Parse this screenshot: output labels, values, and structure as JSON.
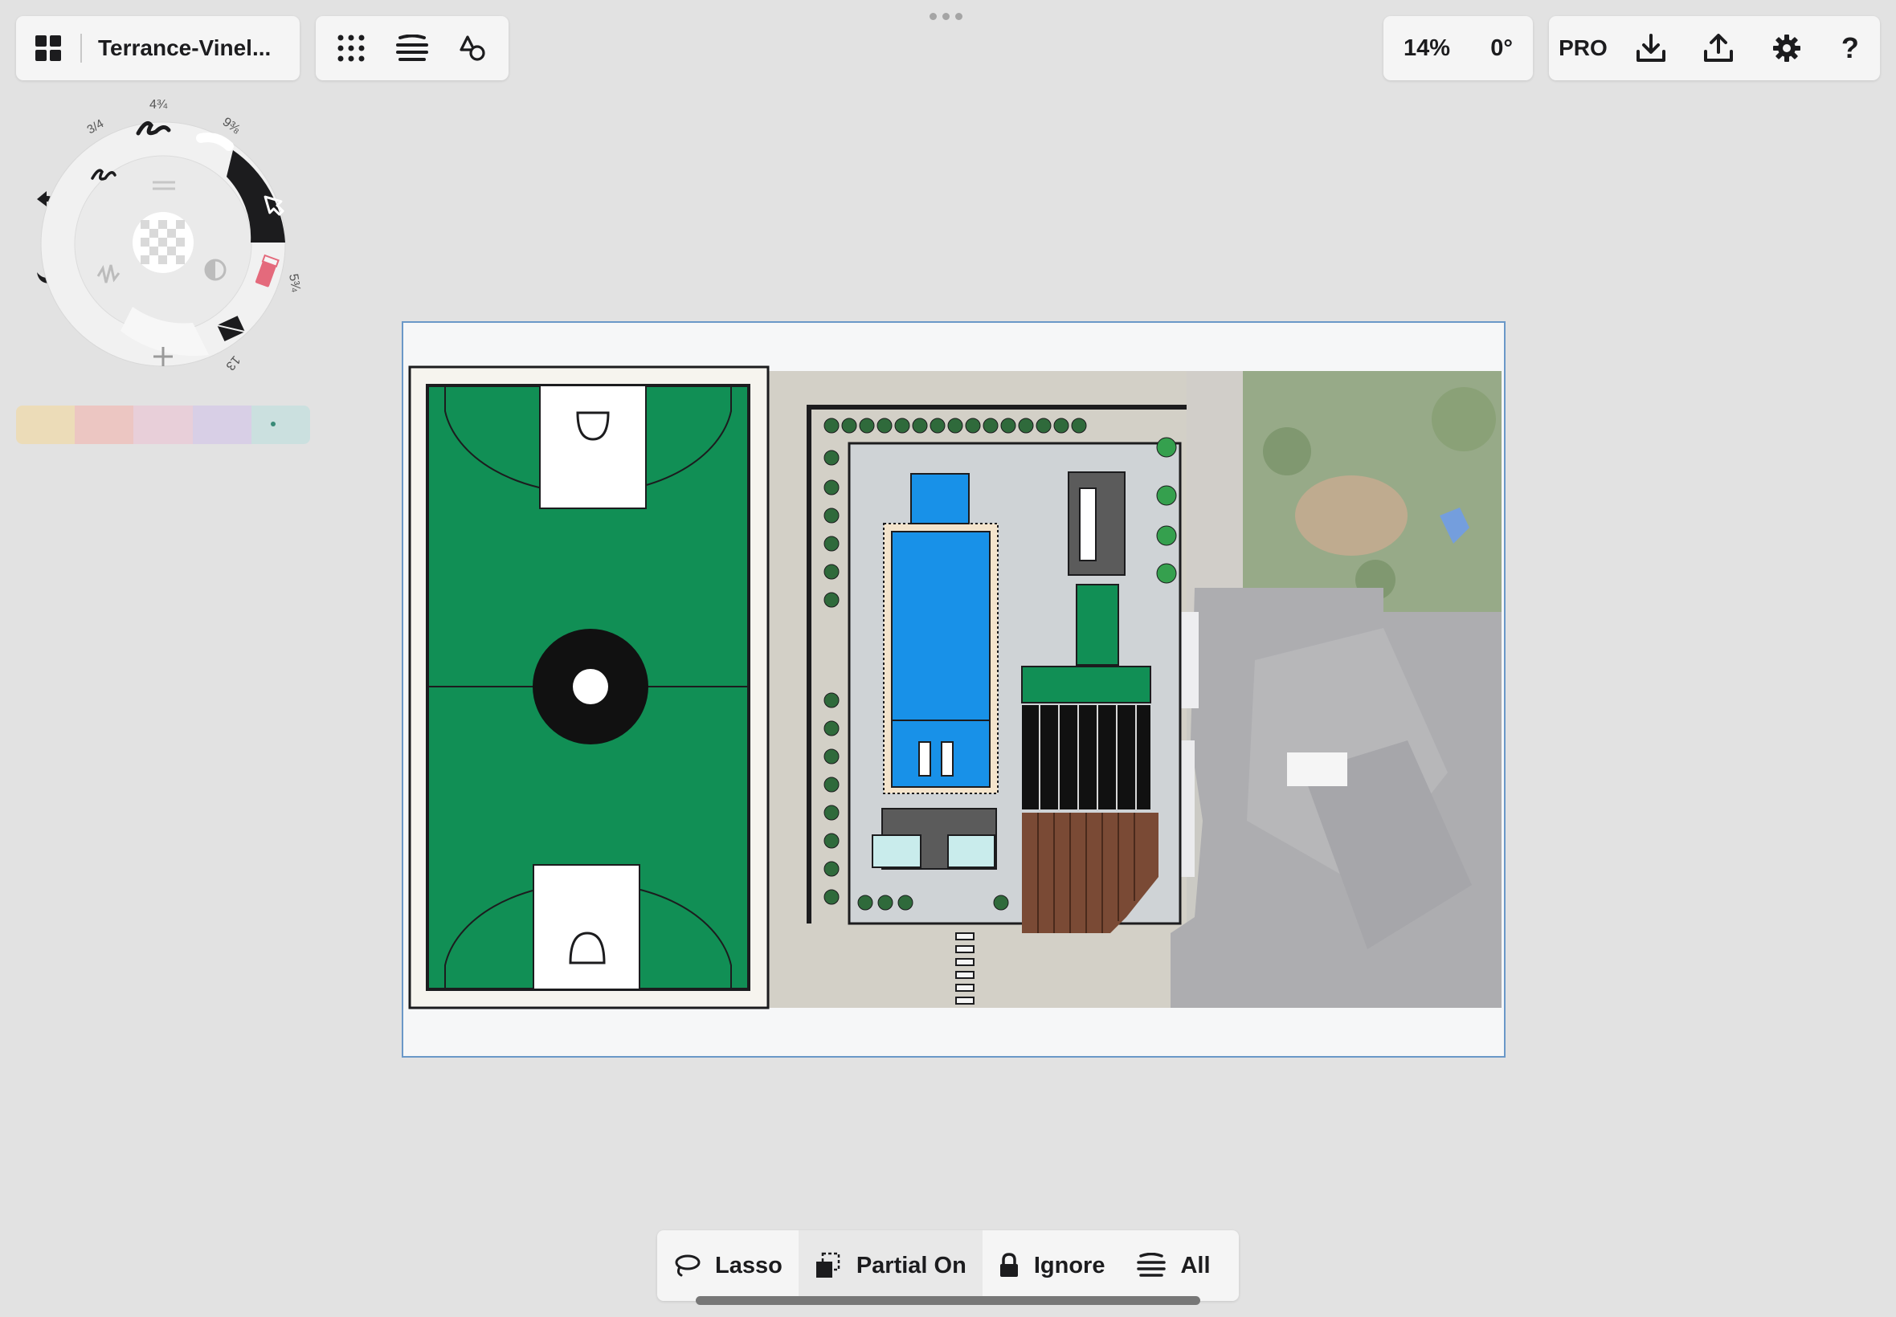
{
  "toolbar": {
    "document_title": "Terrance-Vinel...",
    "zoom_level": "14%",
    "rotation": "0°",
    "pro_label": "PRO"
  },
  "tool_wheel": {
    "brush_sizes": [
      "3/4",
      "4 3/4",
      "9 3/8",
      "5 3/4",
      "13"
    ],
    "active_tool": "selection-arrow-icon"
  },
  "palette": {
    "colors": [
      "#ecdcb8",
      "#ecc6c2",
      "#e8cfd9",
      "#d8cfe6",
      "#cbe0df"
    ]
  },
  "selection_bar": {
    "lasso_label": "Lasso",
    "partial_label": "Partial On",
    "ignore_label": "Ignore",
    "all_label": "All"
  },
  "colors": {
    "court_green": "#118f55",
    "pool_blue": "#1891e8",
    "deck_brown": "#7a4a35",
    "selection_border": "#6a98c8"
  }
}
